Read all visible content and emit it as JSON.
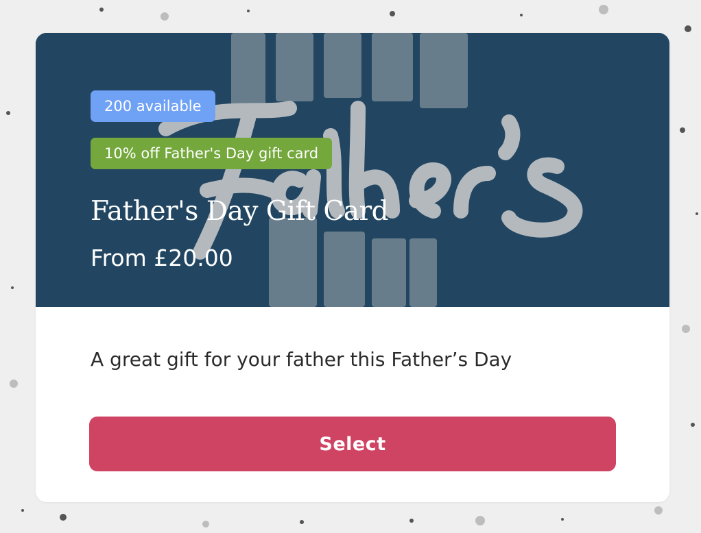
{
  "colors": {
    "page_background": "#eeeeee",
    "hero_background": "#224661",
    "badge_available": "#6fa1f5",
    "badge_discount": "#74a83c",
    "select_button": "#d04463"
  },
  "product": {
    "image_icon": "fathers-day-lettering-image",
    "availability_badge": "200 available",
    "discount_badge": "10% off Father's Day gift card",
    "title": "Father's Day Gift Card",
    "price": "From £20.00",
    "description": "A great gift for your father this Father’s Day",
    "select_label": "Select"
  }
}
